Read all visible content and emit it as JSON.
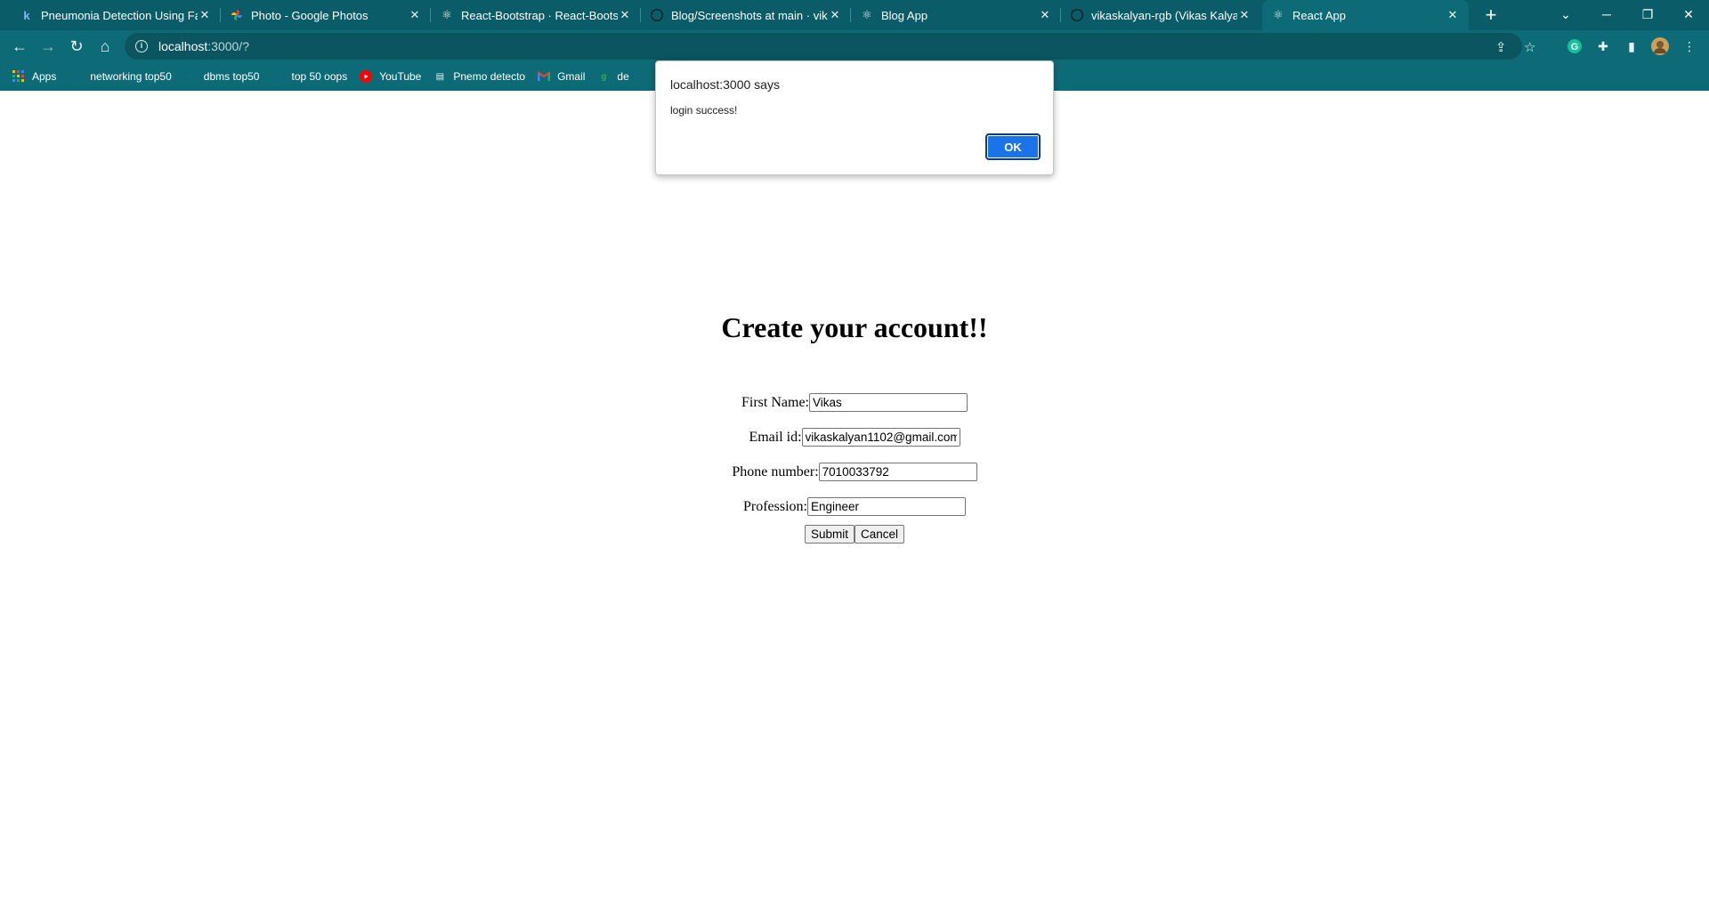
{
  "browser": {
    "tabs": [
      {
        "title": "Pneumonia Detection Using Fas",
        "favicon": "k-letter-icon"
      },
      {
        "title": "Photo - Google Photos",
        "favicon": "google-photos-icon"
      },
      {
        "title": "React-Bootstrap · React-Bootstra",
        "favicon": "react-bootstrap-icon"
      },
      {
        "title": "Blog/Screenshots at main · vikas",
        "favicon": "github-icon"
      },
      {
        "title": "Blog App",
        "favicon": "react-icon"
      },
      {
        "title": "vikaskalyan-rgb (Vikas Kalyan)",
        "favicon": "github-icon"
      },
      {
        "title": "React App",
        "favicon": "react-icon"
      }
    ],
    "address": {
      "host": "localhost",
      "path": ":3000/?"
    },
    "bookmarks": [
      {
        "label": "Apps",
        "icon": "apps-grid-icon"
      },
      {
        "label": "networking top50",
        "icon": "globe-icon"
      },
      {
        "label": "dbms top50",
        "icon": "globe-icon"
      },
      {
        "label": "top 50 oops",
        "icon": "globe-icon"
      },
      {
        "label": "YouTube",
        "icon": "youtube-icon"
      },
      {
        "label": "Pnemo detecto",
        "icon": "document-icon"
      },
      {
        "label": "Gmail",
        "icon": "gmail-icon"
      },
      {
        "label": "de",
        "icon": "bookmark-icon"
      }
    ]
  },
  "alert": {
    "title": "localhost:3000 says",
    "message": "login success!",
    "ok_label": "OK"
  },
  "form": {
    "heading": "Create your account!!",
    "fields": {
      "first_name": {
        "label": "First Name:",
        "value": "Vikas"
      },
      "email": {
        "label": "Email id:",
        "value": "vikaskalyan1102@gmail.com"
      },
      "phone": {
        "label": "Phone number:",
        "value": "7010033792"
      },
      "profession": {
        "label": "Profession:",
        "value": "Engineer"
      }
    },
    "submit_label": "Submit",
    "cancel_label": "Cancel"
  },
  "colors": {
    "frame": "#0d6b78",
    "tabstrip": "#0a5c68",
    "accent": "#1a73e8"
  }
}
